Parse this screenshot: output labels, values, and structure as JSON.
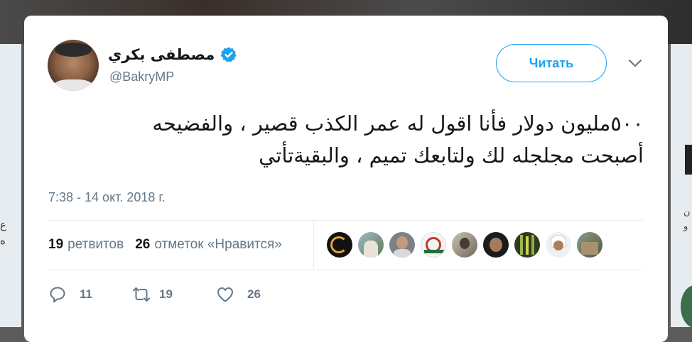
{
  "tweet": {
    "display_name": "مصطفى بكري",
    "handle": "@BakryMP",
    "follow_label": "Читать",
    "text_line1": "٥٠٠مليون دولار فأنا اقول له عمر الكذب قصير ، والفضيحه",
    "text_line2": "أصبحت مجلجله لك ولتابعك تميم  ، والبقيةتأتي",
    "timestamp": "7:38 - 14 окт. 2018 г."
  },
  "stats": {
    "retweets_count": "19",
    "retweets_label": "ретвитов",
    "likes_count": "26",
    "likes_label": "отметок «Нравится»"
  },
  "likers": [
    "avatar-1",
    "avatar-2",
    "avatar-3",
    "avatar-4",
    "avatar-5",
    "avatar-6",
    "avatar-7",
    "avatar-8",
    "avatar-9"
  ],
  "actions": {
    "reply_count": "11",
    "retweet_count": "19",
    "like_count": "26"
  },
  "side_text": {
    "left": "ع\nه",
    "right": "ن\nو"
  },
  "colors": {
    "accent": "#1da1f2",
    "secondary_text": "#657786",
    "primary_text": "#14171a"
  },
  "icons": [
    "verified-badge-icon",
    "chevron-down-icon",
    "reply-icon",
    "retweet-icon",
    "heart-icon"
  ]
}
